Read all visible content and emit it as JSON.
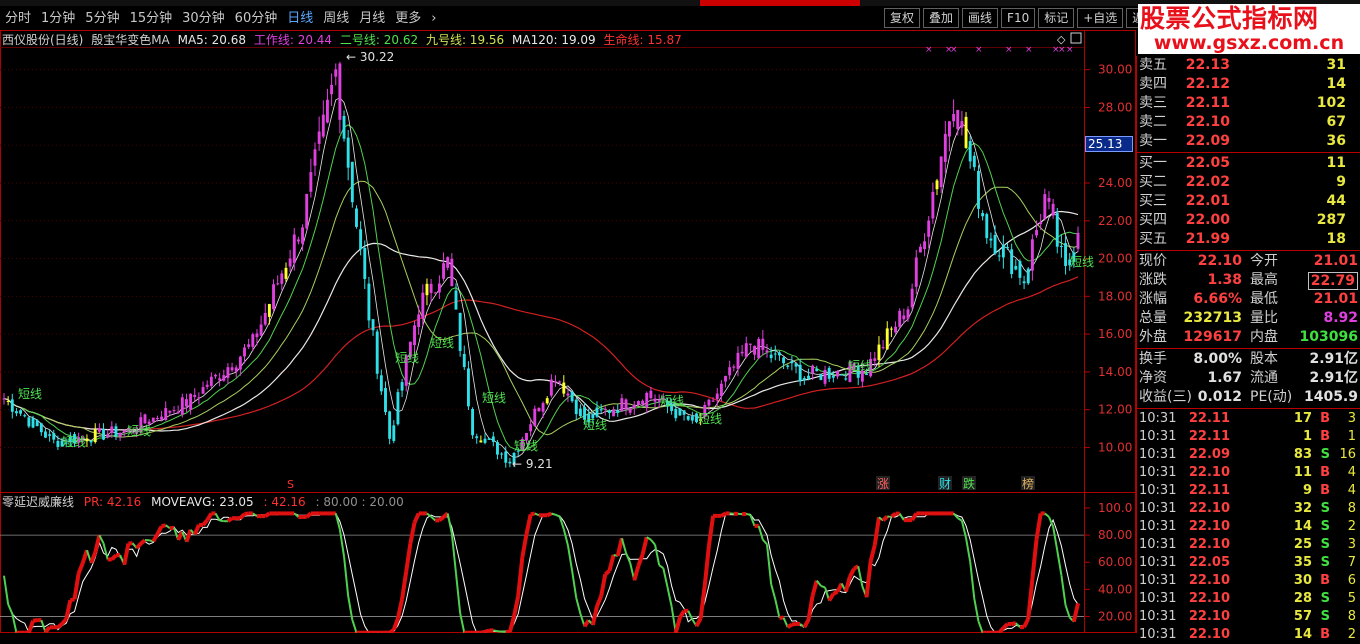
{
  "toolbar": {
    "periods": [
      "分时",
      "1分钟",
      "5分钟",
      "15分钟",
      "30分钟",
      "60分钟",
      "日线",
      "周线",
      "月线",
      "更多"
    ],
    "active_period": "日线",
    "more_icon": "chevron-right-icon",
    "buttons": [
      "复权",
      "叠加",
      "画线",
      "F10",
      "标记",
      "+自选",
      "返回"
    ]
  },
  "logo": {
    "title": "股票公式指标网",
    "url": "www.gsxz.com.cn"
  },
  "main_info": {
    "stock": "西仪股份(日线)",
    "indicator": "殷宝华变色MA",
    "ma5": "MA5: 20.68",
    "work": "工作线: 20.44",
    "line2": "二号线: 20.62",
    "line9": "九号线: 19.56",
    "ma120": "MA120: 19.09",
    "life": "生命线: 15.87"
  },
  "indicator_info": {
    "name": "零延迟威廉线",
    "pr": "PR: 42.16",
    "moveavg": "MOVEAVG: 23.05",
    "val": ": 42.16",
    "levels": ": 80.00 : 20.00"
  },
  "price_axis": [
    "30.00",
    "28.00",
    "26.00",
    "24.00",
    "22.00",
    "20.00",
    "18.00",
    "16.00",
    "14.00",
    "12.00",
    "10.00"
  ],
  "indicator_axis": [
    "100.0",
    "80.00",
    "60.00",
    "40.00",
    "20.00"
  ],
  "crosshair_price": "25.13",
  "annotations": {
    "high": "30.22",
    "low": "9.21",
    "short_label": "短线",
    "markers": [
      "涨",
      "财",
      "跌",
      "榜"
    ],
    "s_marker": "S"
  },
  "chart_data": {
    "type": "candlestick",
    "ylim": [
      8.7,
      31.2
    ],
    "bars": 260,
    "key_points": [
      {
        "bar": 0,
        "close": 12.6
      },
      {
        "bar": 12,
        "close": 10.3
      },
      {
        "bar": 30,
        "close": 10.9
      },
      {
        "bar": 45,
        "close": 12.5
      },
      {
        "bar": 60,
        "close": 15.5
      },
      {
        "bar": 72,
        "close": 22.0
      },
      {
        "bar": 80,
        "close": 29.9
      },
      {
        "bar": 88,
        "close": 17.0
      },
      {
        "bar": 93,
        "close": 10.5
      },
      {
        "bar": 100,
        "close": 17.5
      },
      {
        "bar": 107,
        "close": 19.8
      },
      {
        "bar": 113,
        "close": 11.0
      },
      {
        "bar": 122,
        "close": 9.3
      },
      {
        "bar": 133,
        "close": 13.9
      },
      {
        "bar": 140,
        "close": 11.5
      },
      {
        "bar": 155,
        "close": 12.8
      },
      {
        "bar": 167,
        "close": 11.2
      },
      {
        "bar": 180,
        "close": 15.5
      },
      {
        "bar": 193,
        "close": 13.8
      },
      {
        "bar": 208,
        "close": 14.2
      },
      {
        "bar": 218,
        "close": 17.5
      },
      {
        "bar": 229,
        "close": 28.6
      },
      {
        "bar": 237,
        "close": 21.5
      },
      {
        "bar": 246,
        "close": 19.0
      },
      {
        "bar": 251,
        "close": 23.2
      },
      {
        "bar": 256,
        "close": 19.2
      },
      {
        "bar": 259,
        "close": 21.8
      }
    ],
    "colors": {
      "magenta": "#e040e0",
      "cyan": "#30e0e8",
      "yellow": "#ffff30",
      "red_line": "#d02020",
      "white_line": "#e8e8e8",
      "green_line": "#50d050"
    }
  },
  "quotes": {
    "sell": [
      {
        "label": "卖五",
        "price": "22.13",
        "vol": "31"
      },
      {
        "label": "卖四",
        "price": "22.12",
        "vol": "14"
      },
      {
        "label": "卖三",
        "price": "22.11",
        "vol": "102"
      },
      {
        "label": "卖二",
        "price": "22.10",
        "vol": "67"
      },
      {
        "label": "卖一",
        "price": "22.09",
        "vol": "36"
      }
    ],
    "buy": [
      {
        "label": "买一",
        "price": "22.05",
        "vol": "11"
      },
      {
        "label": "买二",
        "price": "22.02",
        "vol": "9"
      },
      {
        "label": "买三",
        "price": "22.01",
        "vol": "44"
      },
      {
        "label": "买四",
        "price": "22.00",
        "vol": "287"
      },
      {
        "label": "买五",
        "price": "21.99",
        "vol": "18"
      }
    ],
    "stats": [
      {
        "l1": "现价",
        "v1": "22.10",
        "c1": "#ff4040",
        "l2": "今开",
        "v2": "21.01",
        "c2": "#ff4040"
      },
      {
        "l1": "涨跌",
        "v1": "1.38",
        "c1": "#ff4040",
        "l2": "最高",
        "v2": "22.79",
        "c2": "#ff4040"
      },
      {
        "l1": "涨幅",
        "v1": "6.66%",
        "c1": "#ff4040",
        "l2": "最低",
        "v2": "21.01",
        "c2": "#ff4040"
      },
      {
        "l1": "总量",
        "v1": "232713",
        "c1": "#e8e840",
        "l2": "量比",
        "v2": "8.92",
        "c2": "#e040e0"
      },
      {
        "l1": "外盘",
        "v1": "129617",
        "c1": "#ff4040",
        "l2": "内盘",
        "v2": "103096",
        "c2": "#40e040"
      }
    ],
    "stats2": [
      {
        "l1": "换手",
        "v1": "8.00%",
        "c1": "#e0e0e0",
        "l2": "股本",
        "v2": "2.91亿",
        "c2": "#e0e0e0"
      },
      {
        "l1": "净资",
        "v1": "1.67",
        "c1": "#e0e0e0",
        "l2": "流通",
        "v2": "2.91亿",
        "c2": "#e0e0e0"
      },
      {
        "l1": "收益(三)",
        "v1": "0.012",
        "c1": "#e0e0e0",
        "l2": "PE(动)",
        "v2": "1405.9",
        "c2": "#e0e0e0"
      }
    ],
    "ticks": [
      {
        "t": "10:31",
        "p": "22.11",
        "v": "17",
        "d": "B",
        "n": "3"
      },
      {
        "t": "10:31",
        "p": "22.11",
        "v": "1",
        "d": "B",
        "n": "1"
      },
      {
        "t": "10:31",
        "p": "22.09",
        "v": "83",
        "d": "S",
        "n": "16"
      },
      {
        "t": "10:31",
        "p": "22.10",
        "v": "11",
        "d": "B",
        "n": "4"
      },
      {
        "t": "10:31",
        "p": "22.11",
        "v": "9",
        "d": "B",
        "n": "4"
      },
      {
        "t": "10:31",
        "p": "22.10",
        "v": "32",
        "d": "S",
        "n": "8"
      },
      {
        "t": "10:31",
        "p": "22.10",
        "v": "14",
        "d": "S",
        "n": "2"
      },
      {
        "t": "10:31",
        "p": "22.10",
        "v": "25",
        "d": "S",
        "n": "3"
      },
      {
        "t": "10:31",
        "p": "22.05",
        "v": "35",
        "d": "S",
        "n": "7"
      },
      {
        "t": "10:31",
        "p": "22.10",
        "v": "30",
        "d": "B",
        "n": "6"
      },
      {
        "t": "10:31",
        "p": "22.10",
        "v": "28",
        "d": "S",
        "n": "5"
      },
      {
        "t": "10:31",
        "p": "22.10",
        "v": "57",
        "d": "S",
        "n": "8"
      },
      {
        "t": "10:31",
        "p": "22.10",
        "v": "14",
        "d": "B",
        "n": "2"
      }
    ]
  }
}
